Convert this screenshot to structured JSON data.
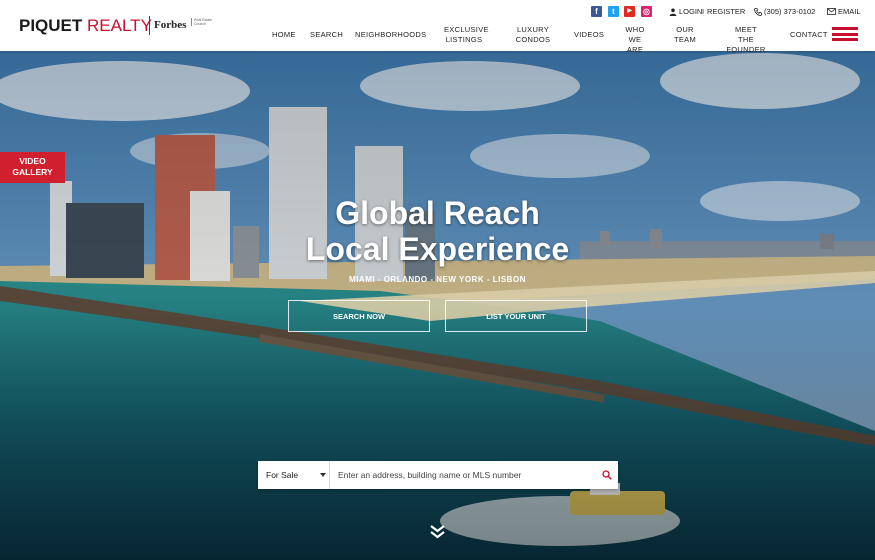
{
  "brand": {
    "name_part1": "PIQUET",
    "name_part2": "REALTY",
    "partner": "Forbes",
    "partner_sub": "Real Estate Council"
  },
  "topbar": {
    "social": [
      {
        "name": "facebook",
        "glyph": "f",
        "color": "#3b5998"
      },
      {
        "name": "twitter",
        "glyph": "t",
        "color": "#1da1f2"
      },
      {
        "name": "youtube",
        "glyph": "▶",
        "color": "#e02a20"
      },
      {
        "name": "instagram",
        "glyph": "◎",
        "color": "#d6246e"
      }
    ],
    "login": "LOGIN",
    "separator": "I",
    "register": "REGISTER",
    "phone": "(305) 373-0102",
    "email": "EMAIL"
  },
  "nav": {
    "home": "HOME",
    "search": "SEARCH",
    "neighborhoods": "NEIGHBORHOODS",
    "exclusive_1": "EXCLUSIVE",
    "exclusive_2": "LISTINGS",
    "luxury_1": "LUXURY",
    "luxury_2": "CONDOS",
    "videos": "VIDEOS",
    "who_1": "WHO WE",
    "who_2": "ARE",
    "team_1": "OUR",
    "team_2": "TEAM",
    "founder_1": "MEET THE",
    "founder_2": "FOUNDER",
    "contact": "CONTACT"
  },
  "hero": {
    "video_tab_1": "VIDEO",
    "video_tab_2": "GALLERY",
    "headline_1": "Global Reach",
    "headline_2": "Local Experience",
    "cities": "MIAMI - ORLANDO - NEW YORK - LISBON",
    "search_now": "SEARCH NOW",
    "list_unit": "LIST YOUR UNIT"
  },
  "search": {
    "type_value": "For Sale",
    "placeholder": "Enter an address, building name or MLS number"
  },
  "colors": {
    "accent": "#c8102e"
  }
}
